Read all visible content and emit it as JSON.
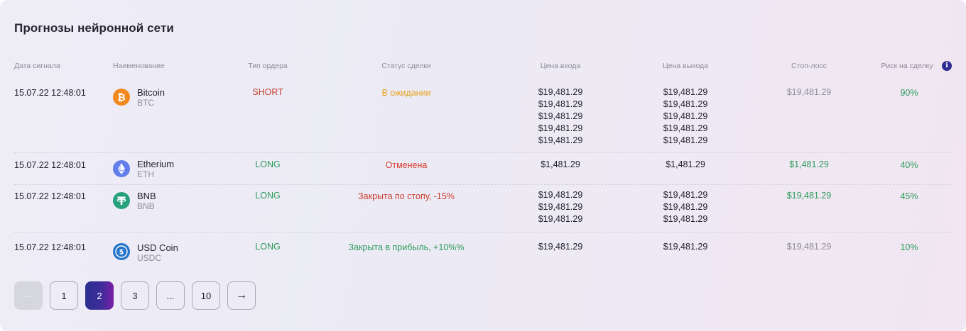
{
  "title": "Прогнозы нейронной сети",
  "headers": {
    "date": "Дата сигнала",
    "name": "Наименование",
    "order_type": "Тип ордера",
    "status": "Статус сделки",
    "entry": "Цена входа",
    "exit": "Цена выхода",
    "stop_loss": "Стоп-лосс",
    "risk": "Риск на сделку",
    "risk_info_icon": "info-icon"
  },
  "rows": [
    {
      "date": "15.07.22 12:48:01",
      "coin": "Bitcoin",
      "symbol": "BTC",
      "icon": "bitcoin-icon",
      "icon_color": "#f2891d",
      "order": "SHORT",
      "status": "В ожидании",
      "entry": [
        "$19,481.29",
        "$19,481.29",
        "$19,481.29",
        "$19,481.29",
        "$19,481.29"
      ],
      "exit": [
        "$19,481.29",
        "$19,481.29",
        "$19,481.29",
        "$19,481.29",
        "$19,481.29"
      ],
      "stop_loss": "$19,481.29",
      "risk": "90%"
    },
    {
      "date": "15.07.22 12:48:01",
      "coin": "Etherium",
      "symbol": "ETH",
      "icon": "ethereum-icon",
      "icon_color": "#627eea",
      "order": "LONG",
      "status": "Отменена",
      "entry": [
        "$1,481.29"
      ],
      "exit": [
        "$1,481.29"
      ],
      "stop_loss": "$1,481.29",
      "risk": "40%"
    },
    {
      "date": "15.07.22 12:48:01",
      "coin": "BNB",
      "symbol": "BNB",
      "icon": "tether-icon",
      "icon_color": "#26a17b",
      "order": "LONG",
      "status": "Закрыта по стопу, -15%",
      "entry": [
        "$19,481.29",
        "$19,481.29",
        "$19,481.29"
      ],
      "exit": [
        "$19,481.29",
        "$19,481.29",
        "$19,481.29"
      ],
      "stop_loss": "$19,481.29",
      "risk": "45%"
    },
    {
      "date": "15.07.22 12:48:01",
      "coin": "USD Coin",
      "symbol": "USDC",
      "icon": "usd-coin-icon",
      "icon_color": "#2775ca",
      "order": "LONG",
      "status": "Закрыта в прибыль, +10%%",
      "entry": [
        "$19,481.29"
      ],
      "exit": [
        "$19,481.29"
      ],
      "stop_loss": "$19,481.29",
      "risk": "10%"
    }
  ],
  "pagination": {
    "prev": "←",
    "pages": [
      "1",
      "2",
      "3",
      "...",
      "10"
    ],
    "current": "2",
    "next": "→"
  }
}
